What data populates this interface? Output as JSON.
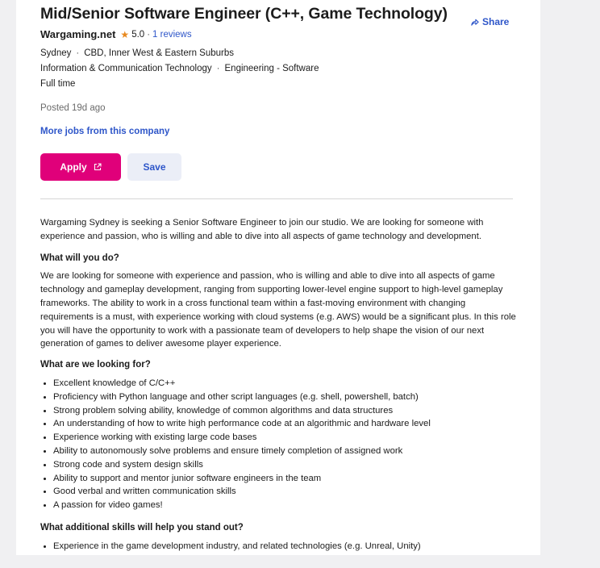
{
  "job": {
    "title": "Mid/Senior Software Engineer (C++, Game Technology)",
    "share_label": "Share",
    "company": "Wargaming.net",
    "rating": "5.0",
    "rating_separator": "·",
    "reviews_label": "1 reviews",
    "location": "Sydney",
    "area": "CBD, Inner West & Eastern Suburbs",
    "classification": "Information & Communication Technology",
    "subclassification": "Engineering - Software",
    "work_type": "Full time",
    "meta_separator": "·",
    "posted": "Posted 19d ago",
    "more_jobs_label": "More jobs from this company",
    "apply_label": "Apply",
    "save_label": "Save"
  },
  "description": {
    "intro": "Wargaming Sydney is seeking a Senior Software Engineer to join our studio. We are looking for someone with experience and passion, who is willing and able to dive into all aspects of game technology and development.",
    "section1_heading": "What will you do?",
    "section1_body": "We are looking for someone with experience and passion, who is willing and able to dive into all aspects of game technology and gameplay development, ranging from supporting lower-level engine support to high-level gameplay frameworks. The ability to work in a cross functional team within a fast-moving environment with changing requirements is a must, with experience working with cloud systems (e.g. AWS) would be a significant plus. In this role you will have the opportunity to work with a passionate team of developers to help shape the vision of our next generation of games to deliver awesome player experience.",
    "section2_heading": "What are we looking for?",
    "requirements": [
      "Excellent knowledge of C/C++",
      "Proficiency with Python language and other script languages (e.g. shell, powershell, batch)",
      "Strong problem solving ability, knowledge of common algorithms and data structures",
      "An understanding of how to write high performance code at an algorithmic and hardware level",
      "Experience working with existing large code bases",
      "Ability to autonomously solve problems and ensure timely completion of assigned work",
      "Strong code and system design skills",
      "Ability to support and mentor junior software engineers in the team",
      "Good verbal and written communication skills",
      "A passion for video games!"
    ],
    "section3_heading": "What additional skills will help you stand out?",
    "extras": [
      "Experience in the game development industry, and related technologies (e.g. Unreal, Unity)"
    ]
  },
  "icons": {
    "share": "share-icon",
    "star": "star-icon",
    "external": "external-link-icon"
  },
  "colors": {
    "accent_pink": "#e0007a",
    "link_blue": "#2e56c9",
    "star_orange": "#e8891f",
    "save_bg": "#ebeef7"
  }
}
